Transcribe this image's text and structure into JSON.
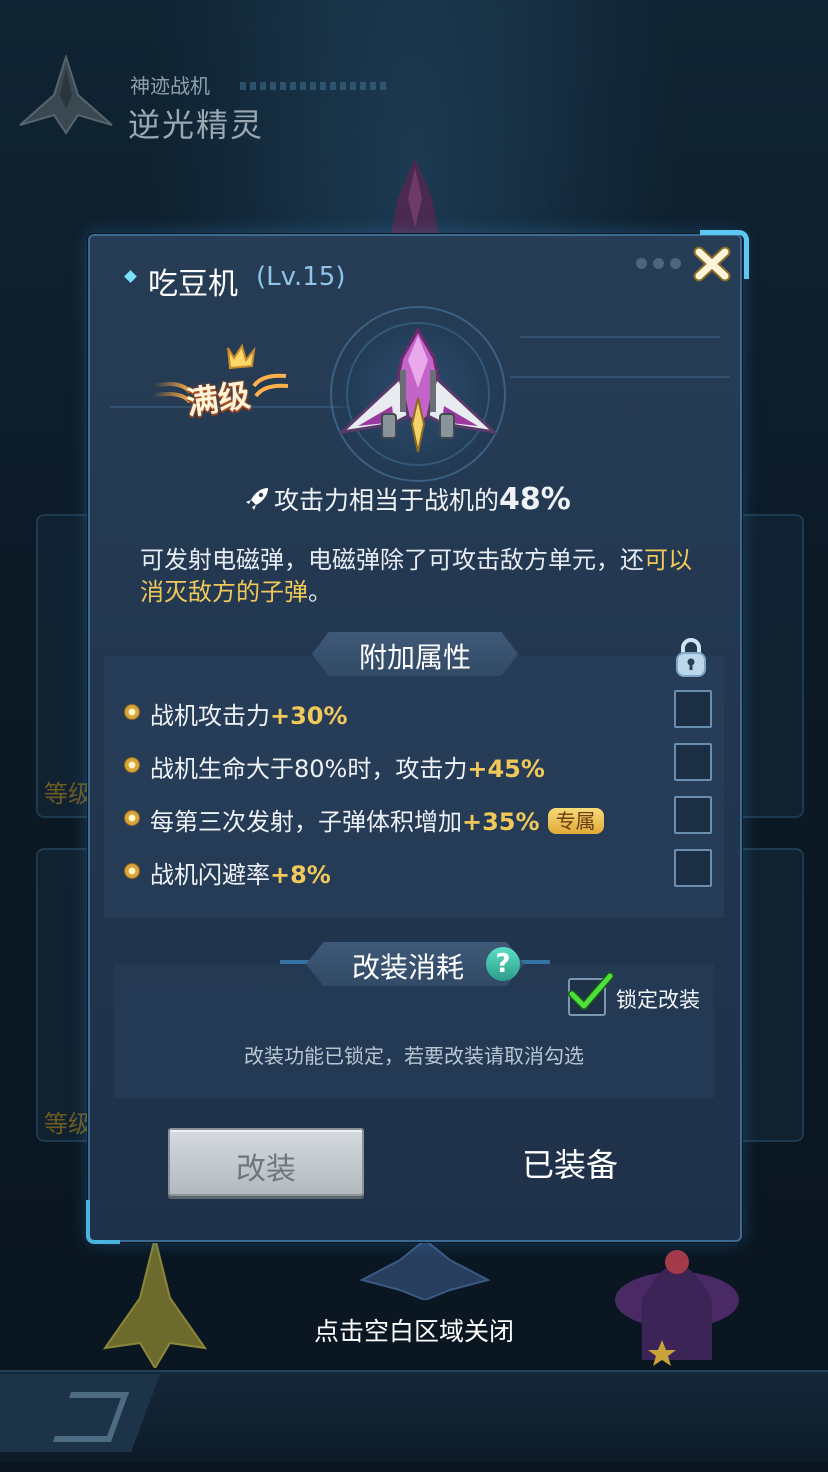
{
  "background": {
    "category_label": "神迹战机",
    "plane_name": "逆光精灵",
    "level_label_left": "等级"
  },
  "modal": {
    "title": "吃豆机",
    "level": "(Lv.15)",
    "max_level_badge": "满级",
    "attack_prefix": "攻击力相当于战机的",
    "attack_percent": "48%",
    "description_normal": "可发射电磁弹，电磁弹除了可攻击敌方单元，还",
    "description_highlight": "可以消灭敌方的子弹",
    "description_end": "。",
    "attributes_title": "附加属性",
    "attributes": [
      {
        "text": "战机攻击力",
        "bonus": "+30%",
        "exclusive": "",
        "locked": false
      },
      {
        "text": "战机生命大于80%时，攻击力",
        "bonus": "+45%",
        "exclusive": "",
        "locked": false
      },
      {
        "text": "每第三次发射，子弹体积增加",
        "bonus": "+35%",
        "exclusive": "专属",
        "locked": false
      },
      {
        "text": "战机闪避率",
        "bonus": "+8%",
        "exclusive": "",
        "locked": false
      }
    ],
    "cost_title": "改装消耗",
    "help_symbol": "?",
    "lock_modify_label": "锁定改装",
    "lock_modify_checked": true,
    "locked_hint": "改装功能已锁定，若要改装请取消勾选",
    "modify_button": "改装",
    "equipped_label": "已装备"
  },
  "close_hint": "点击空白区域关闭",
  "colors": {
    "accent_gold": "#f0c95a",
    "modal_bg": "#243a52",
    "border_blue": "#3b6a92",
    "check_green": "#43d43a"
  },
  "icons": [
    "close-icon",
    "rocket-icon",
    "lock-icon",
    "help-icon",
    "checkmark-icon",
    "crown-icon",
    "back-icon"
  ]
}
